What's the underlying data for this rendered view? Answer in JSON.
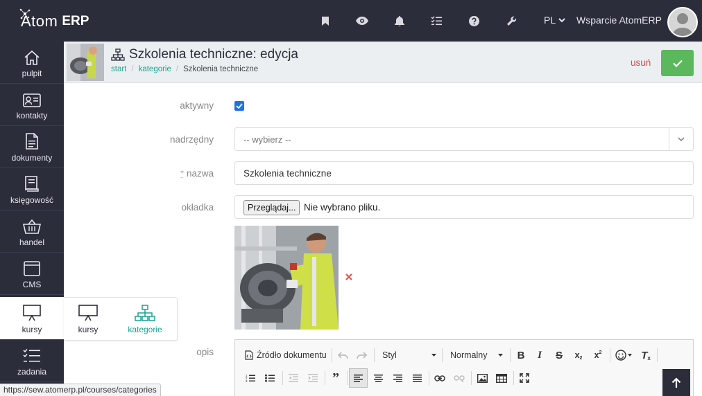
{
  "app": {
    "logo_light": "Atom",
    "logo_bold": "ERP",
    "lang": "PL",
    "support_label": "Wsparcie AtomERP"
  },
  "topbar_icons": [
    "bookmark-icon",
    "eye-icon",
    "bell-icon",
    "tasks-icon",
    "help-icon",
    "wrench-icon"
  ],
  "sidebar": {
    "items": [
      {
        "label": "pulpit",
        "icon": "home-icon"
      },
      {
        "label": "kontakty",
        "icon": "contact-card-icon"
      },
      {
        "label": "dokumenty",
        "icon": "document-icon"
      },
      {
        "label": "księgowość",
        "icon": "book-icon"
      },
      {
        "label": "handel",
        "icon": "basket-icon"
      },
      {
        "label": "CMS",
        "icon": "browser-window-icon"
      },
      {
        "label": "kursy",
        "icon": "presentation-icon",
        "active": true
      },
      {
        "label": "zadania",
        "icon": "tasks-icon"
      }
    ]
  },
  "flyout": {
    "items": [
      {
        "label": "kursy",
        "icon": "presentation-icon"
      },
      {
        "label": "kategorie",
        "icon": "sitemap-icon",
        "active": true
      }
    ]
  },
  "page": {
    "title": "Szkolenia techniczne: edycja",
    "breadcrumb": {
      "start": "start",
      "categories": "kategorie",
      "current": "Szkolenia techniczne"
    },
    "delete_label": "usuń"
  },
  "form": {
    "active_label": "aktywny",
    "active_checked": true,
    "parent_label": "nadrzędny",
    "parent_value": "-- wybierz --",
    "name_required_mark": "*",
    "name_label": "nazwa",
    "name_value": "Szkolenia techniczne",
    "cover_label": "okładka",
    "file_button": "Przeglądaj...",
    "file_status": "Nie wybrano pliku.",
    "description_label": "opis"
  },
  "editor": {
    "source_label": "Źródło dokumentu",
    "style_label": "Styl",
    "format_label": "Normalny"
  },
  "status_url": "https://sew.atomerp.pl/courses/categories",
  "colors": {
    "dark": "#2b2d3b",
    "accent": "#1aa38f",
    "save": "#5cb85c",
    "danger": "#e14b4b"
  }
}
